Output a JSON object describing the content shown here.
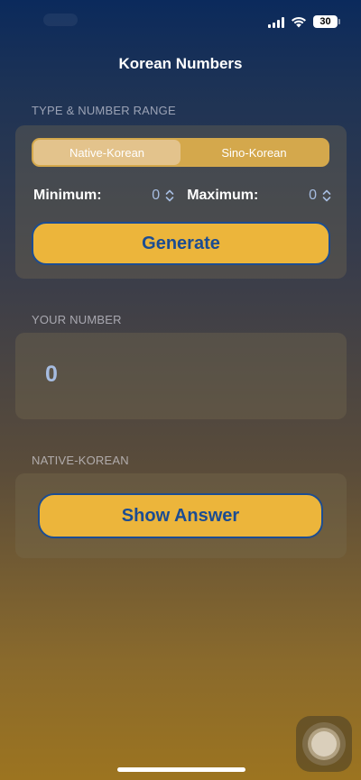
{
  "status_bar": {
    "battery": "30",
    "icons": [
      "cellular-signal-icon",
      "wifi-icon",
      "battery-icon"
    ]
  },
  "nav": {
    "title": "Korean Numbers"
  },
  "type_range": {
    "header": "TYPE & NUMBER RANGE",
    "segments": [
      "Native-Korean",
      "Sino-Korean"
    ],
    "selected_segment": "Native-Korean",
    "minimum_label": "Minimum:",
    "minimum_value": "0",
    "maximum_label": "Maximum:",
    "maximum_value": "0",
    "generate_label": "Generate"
  },
  "your_number": {
    "header": "YOUR NUMBER",
    "value": "0"
  },
  "answer": {
    "header": "NATIVE-KOREAN",
    "show_answer_label": "Show Answer"
  },
  "colors": {
    "button_fill": "#ecb53b",
    "button_text": "#1b4c92",
    "segment_selected": "#e3c38c",
    "segment_background": "#d4a84c",
    "number_text": "#a6bce0"
  }
}
